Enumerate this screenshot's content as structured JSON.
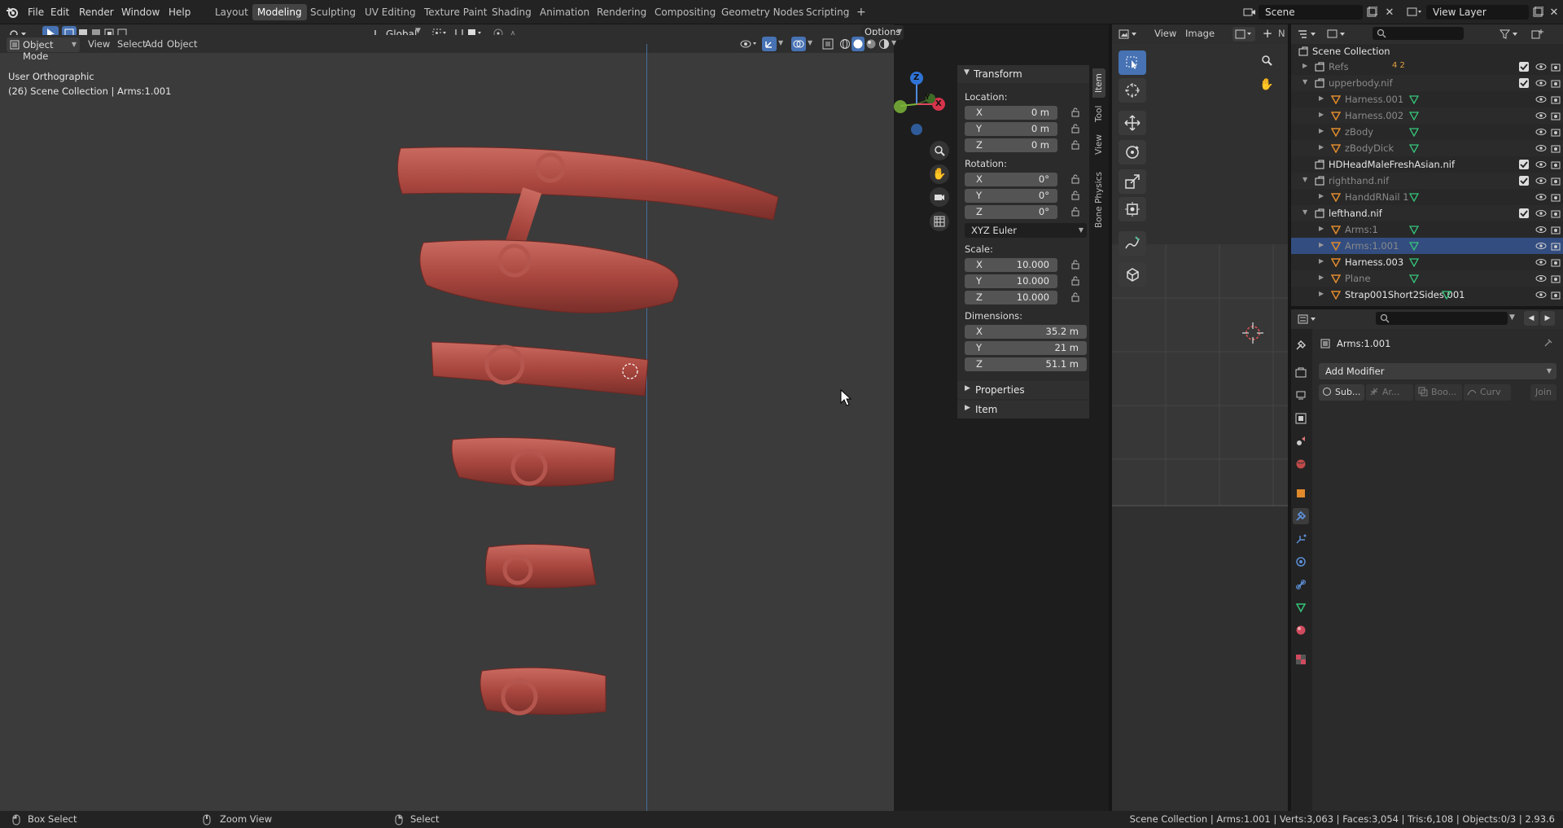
{
  "topbar": {
    "menus": [
      "File",
      "Edit",
      "Render",
      "Window",
      "Help"
    ],
    "workspaces": [
      "Layout",
      "Modeling",
      "Sculpting",
      "UV Editing",
      "Texture Paint",
      "Shading",
      "Animation",
      "Rendering",
      "Compositing",
      "Geometry Nodes",
      "Scripting"
    ],
    "active_workspace": "Modeling",
    "add_tab": "+",
    "scene": "Scene",
    "view_layer": "View Layer"
  },
  "viewport": {
    "mode": "Object Mode",
    "menus": [
      "View",
      "Select",
      "Add",
      "Object"
    ],
    "orientation": "Global",
    "options": "Options",
    "view_name": "User Orthographic",
    "collection_info": "(26) Scene Collection | Arms:1.001",
    "gizmo": {
      "x": "X",
      "y": "Y",
      "z": "Z"
    }
  },
  "npanel": {
    "title": "Transform",
    "location_label": "Location:",
    "location": [
      {
        "axis": "X",
        "value": "0 m"
      },
      {
        "axis": "Y",
        "value": "0 m"
      },
      {
        "axis": "Z",
        "value": "0 m"
      }
    ],
    "rotation_label": "Rotation:",
    "rotation": [
      {
        "axis": "X",
        "value": "0°"
      },
      {
        "axis": "Y",
        "value": "0°"
      },
      {
        "axis": "Z",
        "value": "0°"
      }
    ],
    "rotation_mode": "XYZ Euler",
    "scale_label": "Scale:",
    "scale": [
      {
        "axis": "X",
        "value": "10.000"
      },
      {
        "axis": "Y",
        "value": "10.000"
      },
      {
        "axis": "Z",
        "value": "10.000"
      }
    ],
    "dimensions_label": "Dimensions:",
    "dimensions": [
      {
        "axis": "X",
        "value": "35.2 m"
      },
      {
        "axis": "Y",
        "value": "21 m"
      },
      {
        "axis": "Z",
        "value": "51.1 m"
      }
    ],
    "sections": [
      "Properties",
      "Item"
    ],
    "tabs": [
      "Item",
      "Tool",
      "View",
      "Bone Physics"
    ]
  },
  "image_editor": {
    "menus": [
      "View",
      "Image"
    ],
    "n_label": "N"
  },
  "outliner": {
    "root": "Scene Collection",
    "rows": [
      {
        "name": "Refs",
        "indent": 1,
        "kind": "collection",
        "dim": true,
        "badges": "4  2"
      },
      {
        "name": "upperbody.nif",
        "indent": 1,
        "kind": "collection",
        "dim": true
      },
      {
        "name": "Harness.001",
        "indent": 2,
        "kind": "mesh",
        "dim": true
      },
      {
        "name": "Harness.002",
        "indent": 2,
        "kind": "mesh",
        "dim": true
      },
      {
        "name": "zBody",
        "indent": 2,
        "kind": "mesh",
        "dim": true
      },
      {
        "name": "zBodyDick",
        "indent": 2,
        "kind": "mesh",
        "dim": true
      },
      {
        "name": "HDHeadMaleFreshAsian.nif",
        "indent": 1,
        "kind": "collection",
        "dim": false
      },
      {
        "name": "righthand.nif",
        "indent": 1,
        "kind": "collection",
        "dim": true
      },
      {
        "name": "HanddRNail 1",
        "indent": 2,
        "kind": "mesh",
        "dim": true
      },
      {
        "name": "lefthand.nif",
        "indent": 1,
        "kind": "collection",
        "dim": false
      },
      {
        "name": "Arms:1",
        "indent": 2,
        "kind": "mesh",
        "dim": true
      },
      {
        "name": "Arms:1.001",
        "indent": 2,
        "kind": "mesh",
        "dim": true,
        "selected": true
      },
      {
        "name": "Harness.003",
        "indent": 2,
        "kind": "mesh",
        "dim": false
      },
      {
        "name": "Plane",
        "indent": 2,
        "kind": "mesh",
        "dim": true
      },
      {
        "name": "Strap001Short2Sides.001",
        "indent": 2,
        "kind": "mesh",
        "dim": false
      }
    ]
  },
  "properties": {
    "object_name": "Arms:1.001",
    "add_modifier": "Add Modifier",
    "quick": [
      "Sub...",
      "Ar...",
      "Boo...",
      "Curv",
      "Join"
    ]
  },
  "statusbar": {
    "left": [
      {
        "label": "Box Select"
      },
      {
        "label": "Zoom View"
      },
      {
        "label": "Select"
      }
    ],
    "right": "Scene Collection | Arms:1.001 | Verts:3,063 | Faces:3,054 | Tris:6,108 | Objects:0/3 | 2.93.6"
  },
  "colors": {
    "accent": "#4772b3",
    "strap": "#b0504a",
    "selected_row": "#334d80"
  }
}
